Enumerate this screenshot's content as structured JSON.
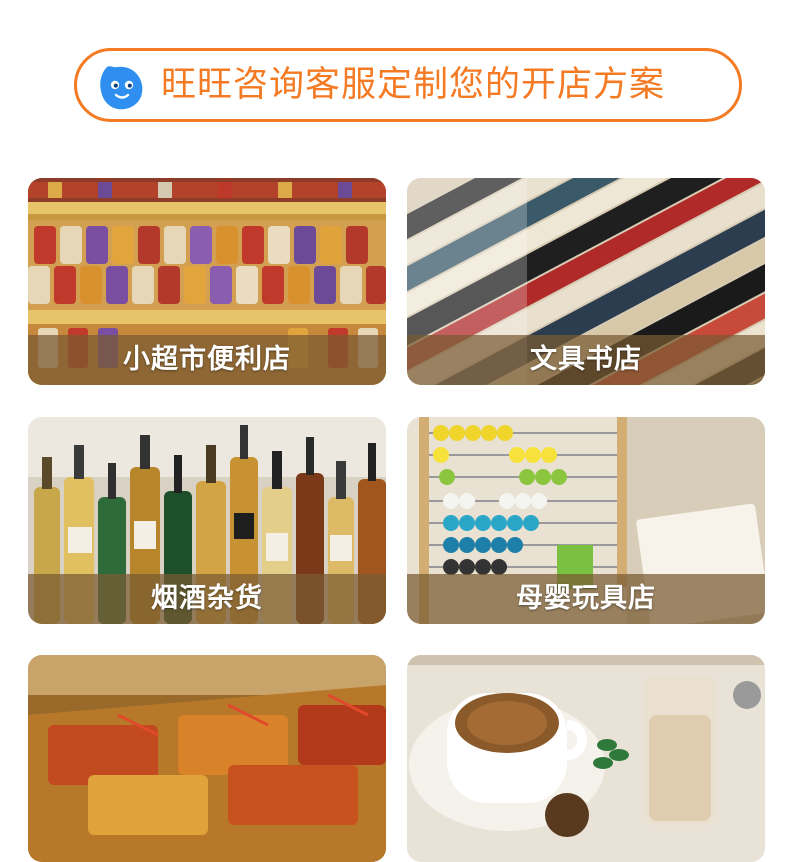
{
  "banner": {
    "text": "旺旺咨询客服定制您的开店方案",
    "icon": "wangwang-chat-icon",
    "accent_color": "#f47a23",
    "icon_color": "#2f8ff0"
  },
  "categories": [
    {
      "label": "小超市便利店",
      "image": "candy-shelf-image"
    },
    {
      "label": "文具书店",
      "image": "books-image"
    },
    {
      "label": "烟酒杂货",
      "image": "liquor-bottles-image"
    },
    {
      "label": "母婴玩具店",
      "image": "abacus-toy-image"
    },
    {
      "label": "",
      "image": "food-buffet-image"
    },
    {
      "label": "",
      "image": "coffee-milktea-image"
    }
  ]
}
